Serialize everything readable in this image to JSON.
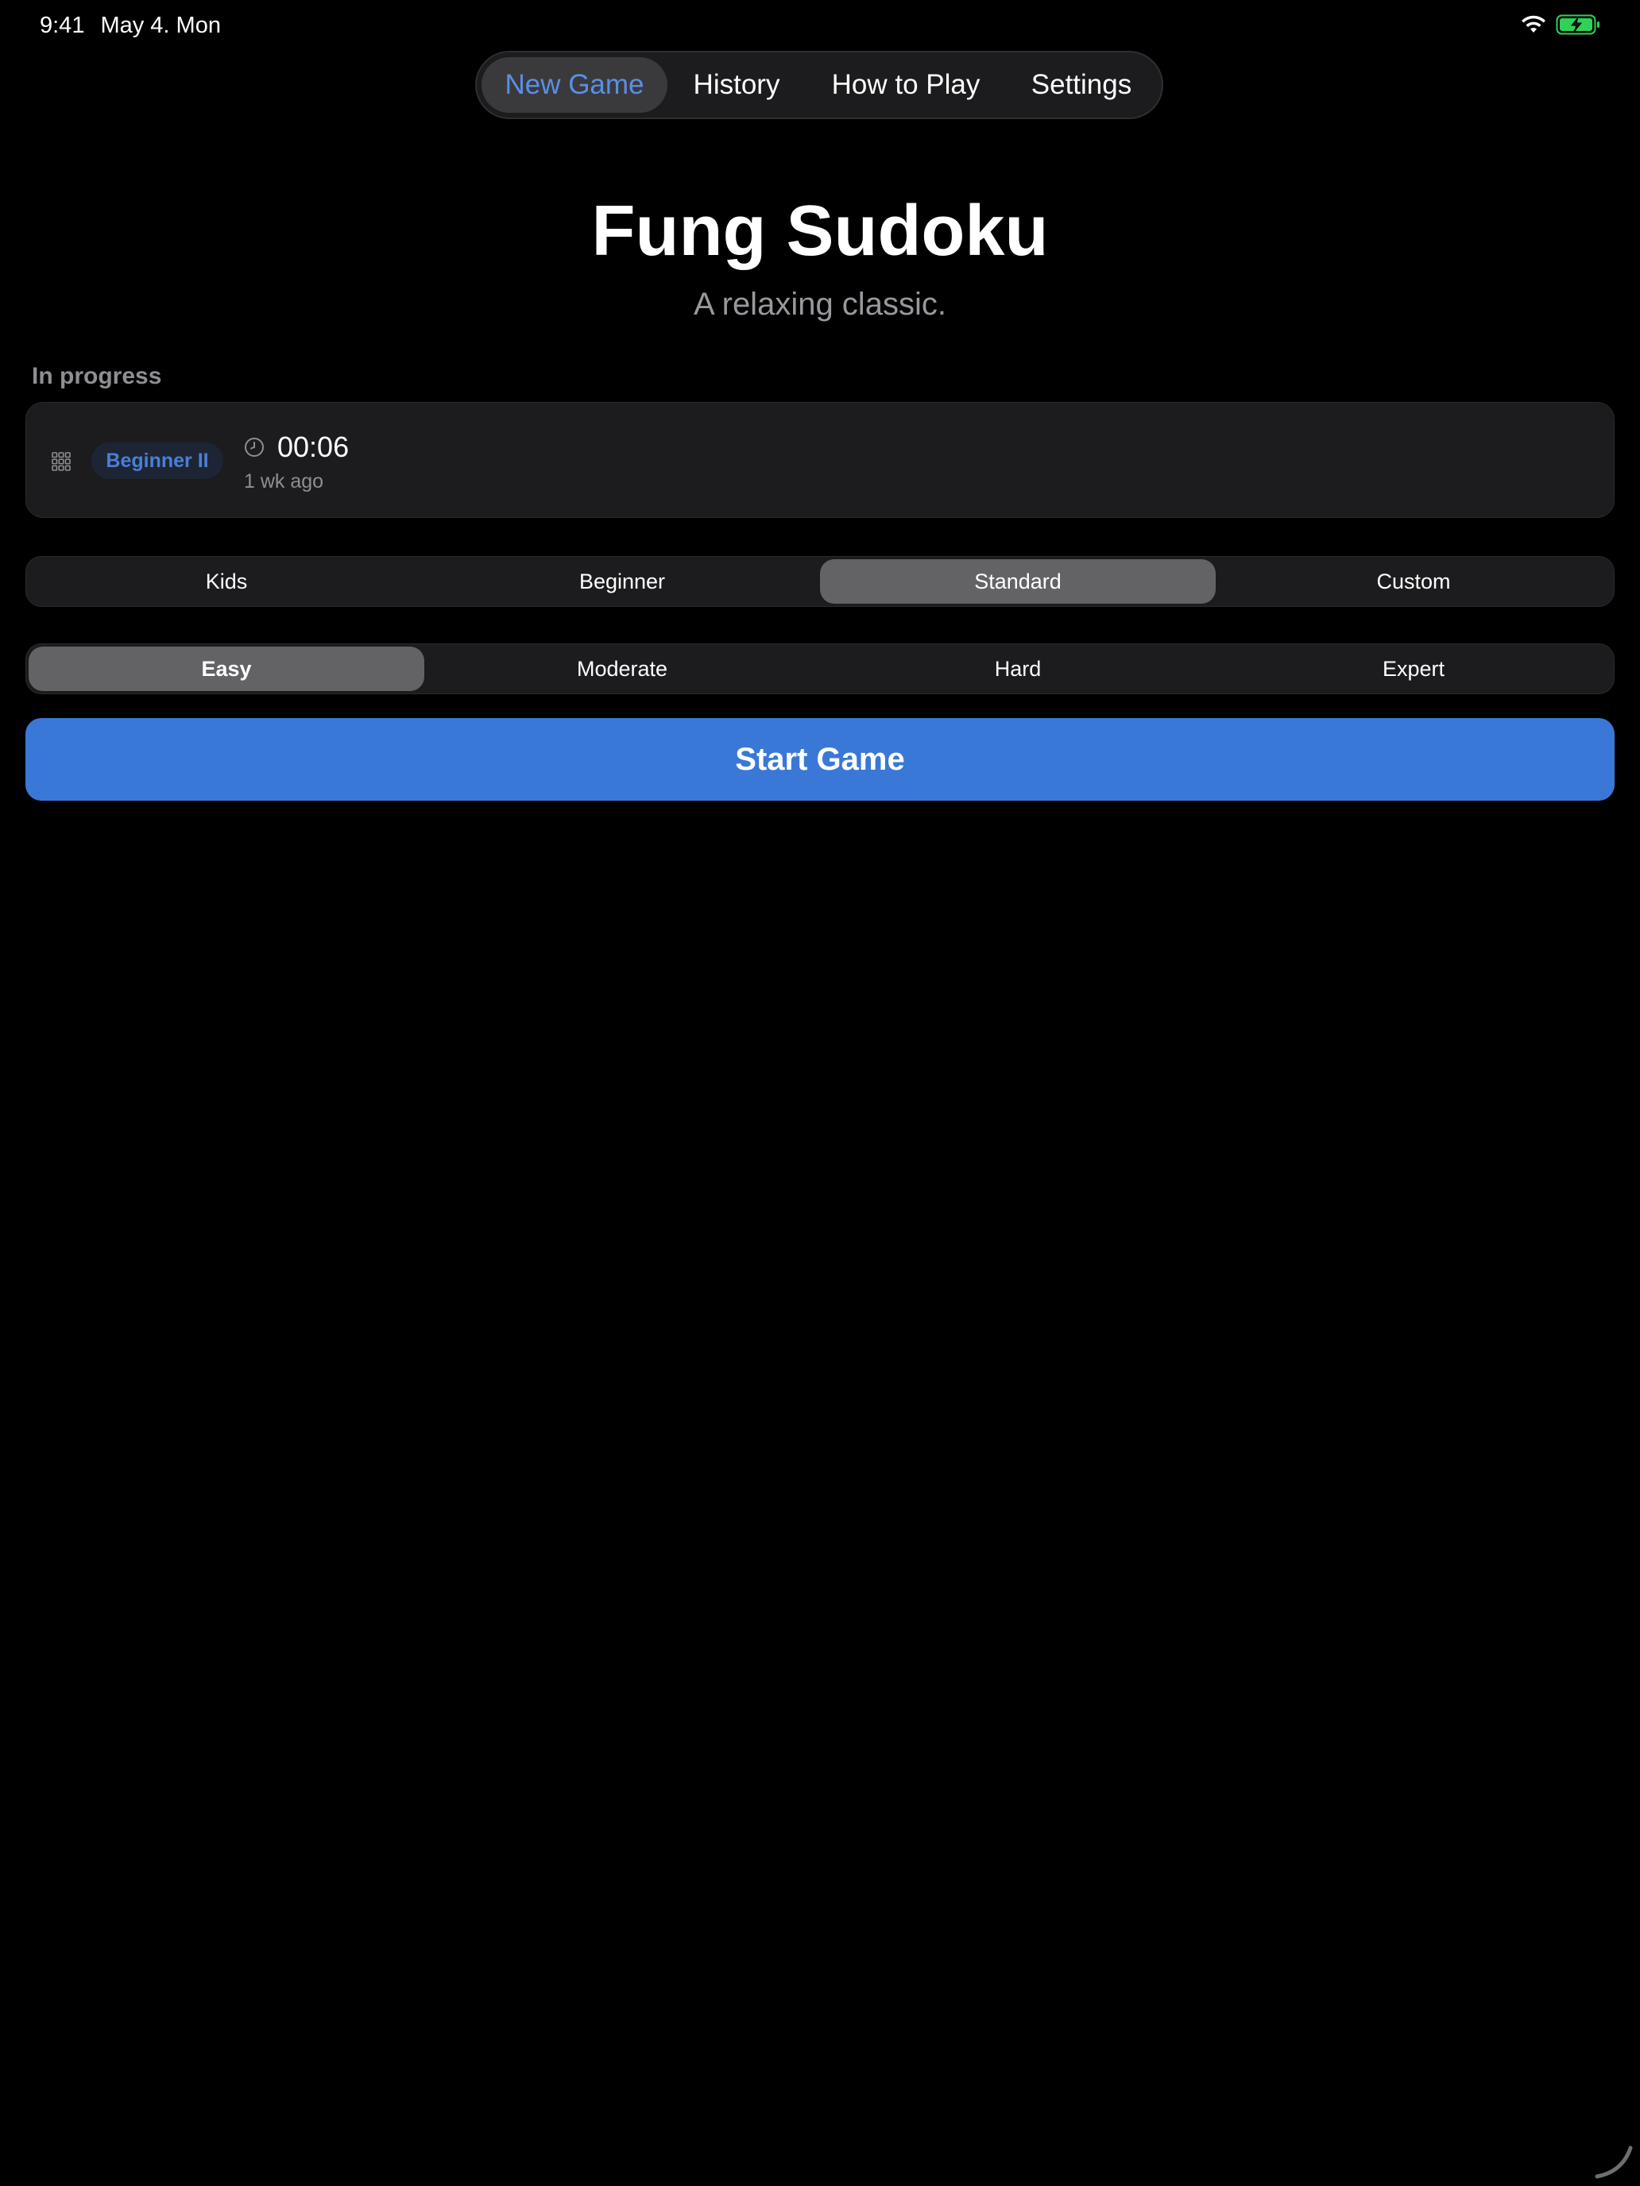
{
  "status_bar": {
    "time": "9:41",
    "date": "May 4. Mon",
    "wifi_icon": "wifi-icon",
    "battery_icon": "battery-charging-icon",
    "battery_color": "#30d158"
  },
  "nav": {
    "tabs": [
      {
        "label": "New Game",
        "active": true
      },
      {
        "label": "History",
        "active": false
      },
      {
        "label": "How to Play",
        "active": false
      },
      {
        "label": "Settings",
        "active": false
      }
    ],
    "active_color": "#5a8fe8"
  },
  "header": {
    "title": "Fung Sudoku",
    "subtitle": "A relaxing classic."
  },
  "in_progress": {
    "section_label": "In progress",
    "games": [
      {
        "icon": "grid-icon",
        "level": "Beginner II",
        "time_icon": "clock-icon",
        "elapsed": "00:06",
        "last_played": "1 wk ago"
      }
    ]
  },
  "game_type": {
    "options": [
      "Kids",
      "Beginner",
      "Standard",
      "Custom"
    ],
    "selected": "Standard"
  },
  "difficulty": {
    "options": [
      "Easy",
      "Moderate",
      "Hard",
      "Expert"
    ],
    "selected": "Easy"
  },
  "start_button": {
    "label": "Start Game",
    "color": "#3a78d8"
  }
}
